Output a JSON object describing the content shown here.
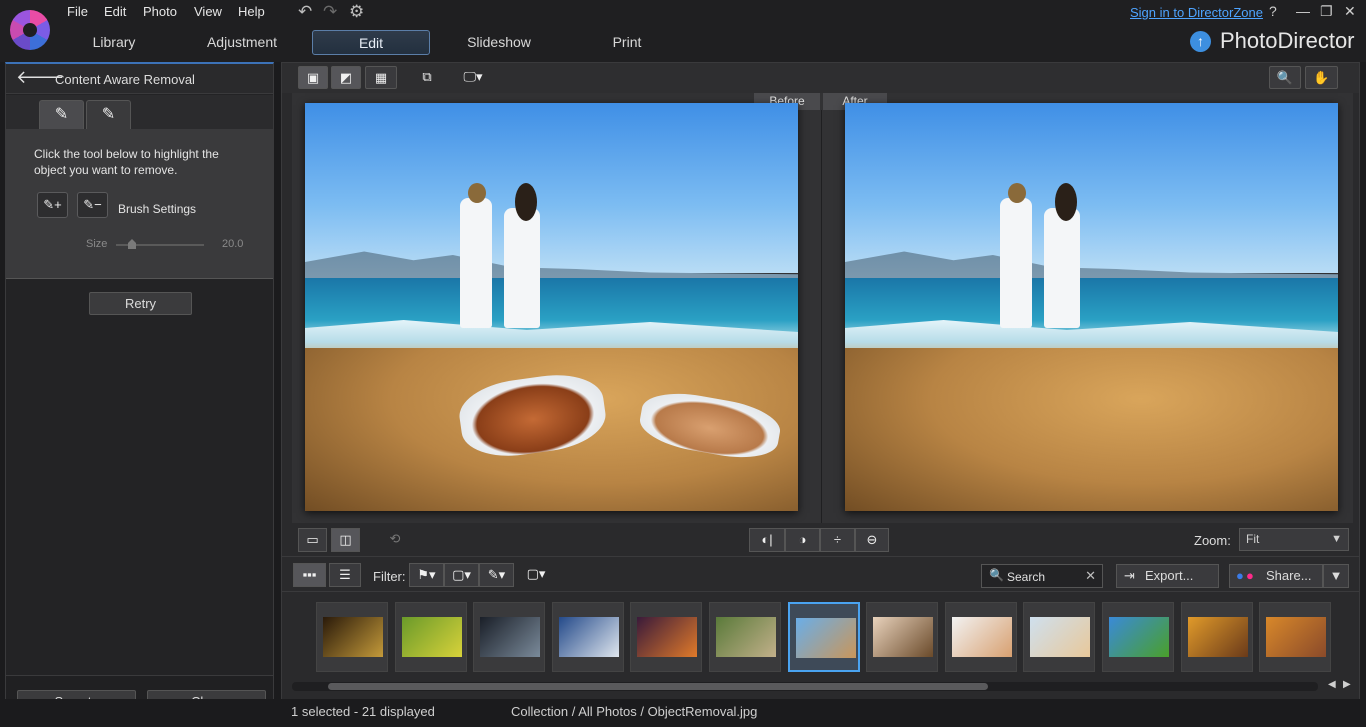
{
  "menu": [
    "File",
    "Edit",
    "Photo",
    "View",
    "Help"
  ],
  "toolbar_icons": [
    "undo-icon",
    "redo-icon",
    "settings-icon"
  ],
  "tabs": [
    {
      "label": "Library",
      "active": false
    },
    {
      "label": "Adjustment",
      "active": false
    },
    {
      "label": "Edit",
      "active": true
    },
    {
      "label": "Slideshow",
      "active": false
    },
    {
      "label": "Print",
      "active": false
    }
  ],
  "signin": "Sign in to DirectorZone",
  "window_controls": [
    "?",
    "—",
    "❐",
    "✕"
  ],
  "brand": {
    "name": "PhotoDirector",
    "accent": "#3d8fe0"
  },
  "panel": {
    "title": "Content Aware Removal",
    "instruction": "Click the tool below to highlight the object you want to remove.",
    "brush_settings": "Brush Settings",
    "size_label": "Size",
    "size_value": "20.0",
    "retry": "Retry",
    "save_to": "Save to",
    "clear": "Clear"
  },
  "viewer": {
    "before": "Before",
    "after": "After"
  },
  "zoom": {
    "label": "Zoom:",
    "value": "Fit"
  },
  "filterbar": {
    "filter_label": "Filter:",
    "search_placeholder": "Search",
    "export": "Export...",
    "share": "Share..."
  },
  "thumbnails": [
    {
      "name": "spiral-shell",
      "colors": [
        "#2a1a0a",
        "#c49a3a"
      ]
    },
    {
      "name": "bicycle-field",
      "colors": [
        "#6a9a2a",
        "#d8d23a"
      ]
    },
    {
      "name": "dark-lake",
      "colors": [
        "#1a1f28",
        "#7a8a9a"
      ]
    },
    {
      "name": "snowy-town",
      "colors": [
        "#244a8a",
        "#dfe6ee"
      ]
    },
    {
      "name": "sunset",
      "colors": [
        "#3a1a3a",
        "#e07a2a"
      ]
    },
    {
      "name": "cat-grass",
      "colors": [
        "#5a7a3a",
        "#c2b08a"
      ]
    },
    {
      "name": "beach-couple",
      "colors": [
        "#6aaee8",
        "#c9965a"
      ]
    },
    {
      "name": "woman-smiling",
      "colors": [
        "#e8d2bc",
        "#6a4a2a"
      ]
    },
    {
      "name": "girl-laughing",
      "colors": [
        "#f2f2f2",
        "#d8a070"
      ]
    },
    {
      "name": "woman-blonde",
      "colors": [
        "#cfe0ee",
        "#e8c89a"
      ]
    },
    {
      "name": "green-valley",
      "colors": [
        "#3a8ad8",
        "#4aa02a"
      ]
    },
    {
      "name": "group-orange",
      "colors": [
        "#e09a2a",
        "#6a3a1a"
      ]
    },
    {
      "name": "group-party",
      "colors": [
        "#d8882a",
        "#8a4a2a"
      ]
    }
  ],
  "status": {
    "selection": "1 selected - 21 displayed",
    "path": "Collection / All Photos / ObjectRemoval.jpg"
  }
}
